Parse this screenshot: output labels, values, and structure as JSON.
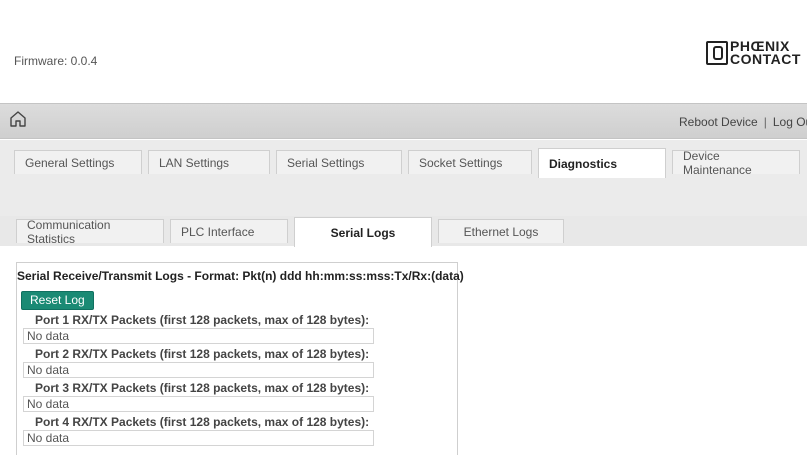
{
  "header": {
    "firmware": "Firmware: 0.0.4",
    "logo_line1": "PHŒNIX",
    "logo_line2": "CONTACT"
  },
  "navbar": {
    "reboot": "Reboot Device",
    "separator": "|",
    "logout": "Log Ou"
  },
  "main_tabs": [
    {
      "label": "General Settings"
    },
    {
      "label": "LAN Settings"
    },
    {
      "label": "Serial Settings"
    },
    {
      "label": "Socket Settings"
    },
    {
      "label": "Diagnostics",
      "active": true
    },
    {
      "label": "Device Maintenance"
    }
  ],
  "sub_tabs": [
    {
      "label": "Communication Statistics"
    },
    {
      "label": "PLC Interface"
    },
    {
      "label": "Serial Logs",
      "active": true
    },
    {
      "label": "Ethernet Logs"
    }
  ],
  "panel": {
    "title": "Serial Receive/Transmit Logs - Format: Pkt(n) ddd hh:mm:ss:mss:Tx/Rx:(data)",
    "reset_label": "Reset Log",
    "ports": [
      {
        "label": "Port 1 RX/TX Packets (first 128 packets, max of 128 bytes):",
        "value": "No data"
      },
      {
        "label": "Port 2 RX/TX Packets (first 128 packets, max of 128 bytes):",
        "value": "No data"
      },
      {
        "label": "Port 3 RX/TX Packets (first 128 packets, max of 128 bytes):",
        "value": "No data"
      },
      {
        "label": "Port 4 RX/TX Packets (first 128 packets, max of 128 bytes):",
        "value": "No data"
      }
    ]
  },
  "colors": {
    "accent_button": "#1a8a74",
    "navbar_bg": "#d6d6d6",
    "tab_bar_bg": "#ebebeb"
  },
  "icons": {
    "home": "home-icon",
    "logo": "phoenix-contact-logo-icon"
  }
}
